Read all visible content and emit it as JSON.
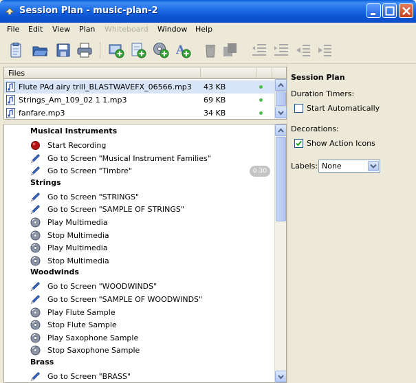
{
  "window": {
    "title": "Session Plan - music-plan-2"
  },
  "menu": [
    {
      "label": "File",
      "disabled": false
    },
    {
      "label": "Edit",
      "disabled": false
    },
    {
      "label": "View",
      "disabled": false
    },
    {
      "label": "Plan",
      "disabled": false
    },
    {
      "label": "Whiteboard",
      "disabled": true
    },
    {
      "label": "Window",
      "disabled": false
    },
    {
      "label": "Help",
      "disabled": false
    }
  ],
  "files": {
    "header": "Files",
    "items": [
      {
        "name": "Flute PAd airy trill_BLASTWAVEFX_06566.mp3",
        "size": "43 KB"
      },
      {
        "name": "Strings_Am_109_02 1 1.mp3",
        "size": "69 KB"
      },
      {
        "name": "fanfare.mp3",
        "size": "34 KB"
      }
    ]
  },
  "plan": {
    "timer_badge": "0:30",
    "sections": [
      {
        "title": "Musical Instruments",
        "items": [
          {
            "type": "record",
            "label": "Start Recording"
          },
          {
            "type": "screen",
            "label": "Go to Screen \"Musical Instrument Families\""
          },
          {
            "type": "screen",
            "label": "Go to Screen \"Timbre\""
          }
        ]
      },
      {
        "title": "Strings",
        "items": [
          {
            "type": "screen",
            "label": "Go to Screen \"STRINGS\""
          },
          {
            "type": "screen",
            "label": "Go to Screen \"SAMPLE OF STRINGS\""
          },
          {
            "type": "media",
            "label": "Play Multimedia"
          },
          {
            "type": "media",
            "label": "Stop Multimedia"
          },
          {
            "type": "media",
            "label": "Play Multimedia"
          },
          {
            "type": "media",
            "label": "Stop Multimedia"
          }
        ]
      },
      {
        "title": "Woodwinds",
        "items": [
          {
            "type": "screen",
            "label": "Go to Screen \"WOODWINDS\""
          },
          {
            "type": "screen",
            "label": "Go to Screen \"SAMPLE OF WOODWINDS\""
          },
          {
            "type": "media",
            "label": "Play Flute Sample"
          },
          {
            "type": "media",
            "label": "Stop Flute Sample"
          },
          {
            "type": "media",
            "label": "Play Saxophone Sample"
          },
          {
            "type": "media",
            "label": "Stop Saxophone Sample"
          }
        ]
      },
      {
        "title": "Brass",
        "items": [
          {
            "type": "screen",
            "label": "Go to Screen \"BRASS\""
          }
        ]
      }
    ]
  },
  "side": {
    "title": "Session Plan",
    "duration_label": "Duration Timers:",
    "start_auto_label": "Start Automatically",
    "start_auto_checked": false,
    "decorations_label": "Decorations:",
    "show_icons_label": "Show Action Icons",
    "show_icons_checked": true,
    "labels_label": "Labels:",
    "labels_value": "None"
  },
  "icons": {
    "toolbar": [
      "new-plan-icon",
      "open-icon",
      "save-icon",
      "print-icon",
      "add-screen-icon",
      "add-note-icon",
      "add-multimedia-icon",
      "add-text-icon",
      "delete-icon",
      "duplicate-icon",
      "outdent-icon",
      "indent-icon",
      "move-left-icon",
      "move-right-icon"
    ]
  }
}
